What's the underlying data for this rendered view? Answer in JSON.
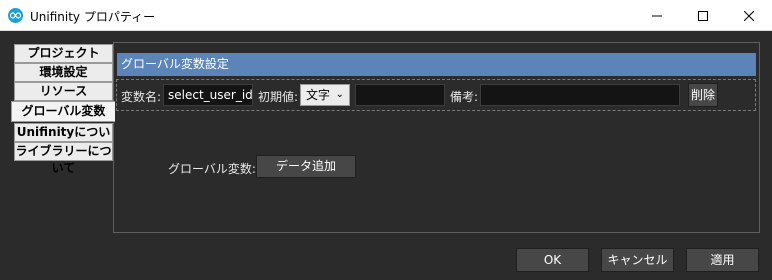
{
  "window": {
    "title": "Unifinity プロパティー",
    "icon": "unifinity-logo-icon",
    "controls": {
      "minimize": "minimize-icon",
      "maximize": "maximize-icon",
      "close": "close-icon"
    }
  },
  "tabs": [
    {
      "label": "プロジェクト",
      "selected": false
    },
    {
      "label": "環境設定",
      "selected": false
    },
    {
      "label": "リソース",
      "selected": false
    },
    {
      "label": "グローバル変数",
      "selected": true
    },
    {
      "label": "Unifinityについて",
      "selected": false
    },
    {
      "label": "ライブラリーについて",
      "selected": false
    }
  ],
  "panel": {
    "header": "グローバル変数設定",
    "row": {
      "name_label": "変数名:",
      "name_value": "select_user_id",
      "init_label": "初期値:",
      "type_value": "文字",
      "init_value": "",
      "note_label": "備考:",
      "note_value": "",
      "delete_label": "削除"
    },
    "global_var_label": "グローバル変数:",
    "add_data_label": "データ追加"
  },
  "footer": {
    "ok_label": "OK",
    "cancel_label": "キャンセル",
    "apply_label": "適用"
  },
  "colors": {
    "header_bg": "#5b85b9",
    "window_bg": "#2b2b2b",
    "input_bg": "#141414",
    "button_bg": "#474747",
    "tab_bg": "#ececec"
  }
}
